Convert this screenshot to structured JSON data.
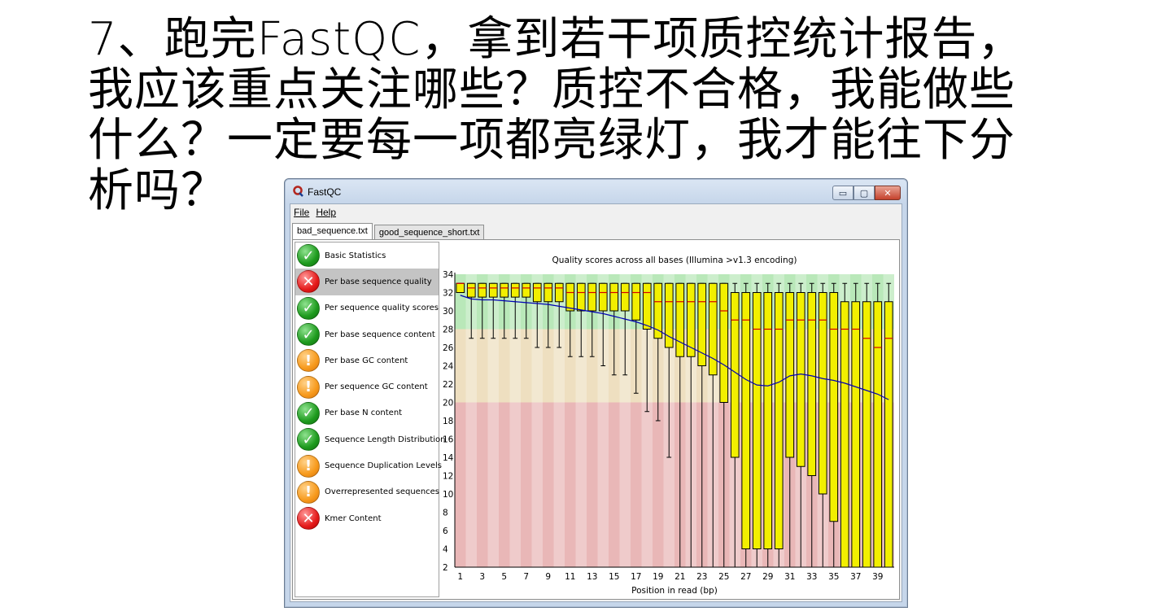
{
  "slide": {
    "title_lines": [
      "7、跑完FastQC，拿到若干项质控统计报告，",
      "我应该重点关注哪些？质控不合格，我能做些",
      "什么？一定要每一项都亮绿灯，我才能往下分",
      "析吗？"
    ]
  },
  "window": {
    "title": "FastQC",
    "menu": {
      "file": "File",
      "help": "Help"
    },
    "controls": {
      "minimize": "▭",
      "maximize": "▢",
      "close": "✕"
    },
    "tabs": [
      {
        "label": "bad_sequence.txt",
        "active": true
      },
      {
        "label": "good_sequence_short.txt",
        "active": false
      }
    ]
  },
  "modules": [
    {
      "label": "Basic Statistics",
      "status": "pass",
      "icon": "check-icon"
    },
    {
      "label": "Per base sequence quality",
      "status": "fail",
      "icon": "cross-icon",
      "selected": true
    },
    {
      "label": "Per sequence quality scores",
      "status": "pass",
      "icon": "check-icon"
    },
    {
      "label": "Per base sequence content",
      "status": "pass",
      "icon": "check-icon"
    },
    {
      "label": "Per base GC content",
      "status": "warn",
      "icon": "exclamation-icon"
    },
    {
      "label": "Per sequence GC content",
      "status": "warn",
      "icon": "exclamation-icon"
    },
    {
      "label": "Per base N content",
      "status": "pass",
      "icon": "check-icon"
    },
    {
      "label": "Sequence Length Distribution",
      "status": "pass",
      "icon": "check-icon"
    },
    {
      "label": "Sequence Duplication Levels",
      "status": "warn",
      "icon": "exclamation-icon"
    },
    {
      "label": "Overrepresented sequences",
      "status": "warn",
      "icon": "exclamation-icon"
    },
    {
      "label": "Kmer Content",
      "status": "fail",
      "icon": "cross-icon"
    }
  ],
  "status_colors": {
    "pass": "#1e9b1e",
    "warn": "#f79a1c",
    "fail": "#e51c1c"
  },
  "chart_data": {
    "type": "box",
    "title": "Quality scores across all bases (Illumina >v1.3 encoding)",
    "xlabel": "Position in read (bp)",
    "ylabel": "",
    "ylim": [
      2,
      34
    ],
    "yticks": [
      2,
      4,
      6,
      8,
      10,
      12,
      14,
      16,
      18,
      20,
      22,
      24,
      26,
      28,
      30,
      32,
      34
    ],
    "xticks": [
      1,
      3,
      5,
      7,
      9,
      11,
      13,
      15,
      17,
      19,
      21,
      23,
      25,
      27,
      29,
      31,
      33,
      35,
      37,
      39
    ],
    "zones": [
      {
        "from": 28,
        "to": 34,
        "color": "#b9e8b9"
      },
      {
        "from": 20,
        "to": 28,
        "color": "#eedfc0"
      },
      {
        "from": 2,
        "to": 20,
        "color": "#e9b7b7"
      }
    ],
    "colors": {
      "box_fill": "#f2ef00",
      "box_stroke": "#000000",
      "median": "#d40000",
      "mean": "#0000b4",
      "whisker": "#000000"
    },
    "positions": [
      1,
      2,
      3,
      4,
      5,
      6,
      7,
      8,
      9,
      10,
      11,
      12,
      13,
      14,
      15,
      16,
      17,
      18,
      19,
      20,
      21,
      22,
      23,
      24,
      25,
      26,
      27,
      28,
      29,
      30,
      31,
      32,
      33,
      34,
      35,
      36,
      37,
      38,
      39,
      40
    ],
    "box_stats": [
      {
        "low": 32,
        "q1": 32,
        "median": 33,
        "q3": 33,
        "high": 33
      },
      {
        "low": 27,
        "q1": 31.5,
        "median": 32.5,
        "q3": 33,
        "high": 33
      },
      {
        "low": 27,
        "q1": 31.5,
        "median": 32.5,
        "q3": 33,
        "high": 33
      },
      {
        "low": 27,
        "q1": 31.5,
        "median": 32.5,
        "q3": 33,
        "high": 33
      },
      {
        "low": 27,
        "q1": 31.5,
        "median": 32.5,
        "q3": 33,
        "high": 33
      },
      {
        "low": 27,
        "q1": 31.5,
        "median": 32.5,
        "q3": 33,
        "high": 33
      },
      {
        "low": 27,
        "q1": 31.5,
        "median": 32.5,
        "q3": 33,
        "high": 33
      },
      {
        "low": 26,
        "q1": 31,
        "median": 32.5,
        "q3": 33,
        "high": 33
      },
      {
        "low": 26,
        "q1": 31,
        "median": 32.5,
        "q3": 33,
        "high": 33
      },
      {
        "low": 26,
        "q1": 31,
        "median": 32.5,
        "q3": 33,
        "high": 33
      },
      {
        "low": 25,
        "q1": 30,
        "median": 32,
        "q3": 33,
        "high": 33
      },
      {
        "low": 25,
        "q1": 30,
        "median": 32,
        "q3": 33,
        "high": 33
      },
      {
        "low": 25,
        "q1": 30,
        "median": 32,
        "q3": 33,
        "high": 33
      },
      {
        "low": 24,
        "q1": 30,
        "median": 32,
        "q3": 33,
        "high": 33
      },
      {
        "low": 23,
        "q1": 30,
        "median": 32,
        "q3": 33,
        "high": 33
      },
      {
        "low": 23,
        "q1": 30,
        "median": 32,
        "q3": 33,
        "high": 33
      },
      {
        "low": 21,
        "q1": 29,
        "median": 32,
        "q3": 33,
        "high": 33
      },
      {
        "low": 19,
        "q1": 28,
        "median": 32,
        "q3": 33,
        "high": 33
      },
      {
        "low": 18,
        "q1": 27,
        "median": 31,
        "q3": 33,
        "high": 33
      },
      {
        "low": 14,
        "q1": 26,
        "median": 31,
        "q3": 33,
        "high": 33
      },
      {
        "low": 2,
        "q1": 25,
        "median": 31,
        "q3": 33,
        "high": 33
      },
      {
        "low": 2,
        "q1": 25,
        "median": 31,
        "q3": 33,
        "high": 33
      },
      {
        "low": 2,
        "q1": 24,
        "median": 31,
        "q3": 33,
        "high": 33
      },
      {
        "low": 2,
        "q1": 23,
        "median": 31,
        "q3": 33,
        "high": 33
      },
      {
        "low": 2,
        "q1": 20,
        "median": 30,
        "q3": 33,
        "high": 33
      },
      {
        "low": 2,
        "q1": 14,
        "median": 29,
        "q3": 32,
        "high": 33
      },
      {
        "low": 2,
        "q1": 4,
        "median": 29,
        "q3": 32,
        "high": 33
      },
      {
        "low": 2,
        "q1": 4,
        "median": 28,
        "q3": 32,
        "high": 33
      },
      {
        "low": 2,
        "q1": 4,
        "median": 28,
        "q3": 32,
        "high": 33
      },
      {
        "low": 2,
        "q1": 4,
        "median": 28,
        "q3": 32,
        "high": 33
      },
      {
        "low": 2,
        "q1": 14,
        "median": 29,
        "q3": 32,
        "high": 33
      },
      {
        "low": 2,
        "q1": 13,
        "median": 29,
        "q3": 32,
        "high": 33
      },
      {
        "low": 2,
        "q1": 12,
        "median": 29,
        "q3": 32,
        "high": 33
      },
      {
        "low": 2,
        "q1": 10,
        "median": 29,
        "q3": 32,
        "high": 33
      },
      {
        "low": 2,
        "q1": 7,
        "median": 28,
        "q3": 32,
        "high": 33
      },
      {
        "low": 2,
        "q1": 2,
        "median": 28,
        "q3": 31,
        "high": 33
      },
      {
        "low": 2,
        "q1": 2,
        "median": 28,
        "q3": 31,
        "high": 33
      },
      {
        "low": 2,
        "q1": 2,
        "median": 27,
        "q3": 31,
        "high": 33
      },
      {
        "low": 2,
        "q1": 2,
        "median": 26,
        "q3": 31,
        "high": 33
      },
      {
        "low": 2,
        "q1": 2,
        "median": 27,
        "q3": 31,
        "high": 33
      }
    ],
    "mean": [
      31.7,
      31.3,
      31.2,
      31.2,
      31.1,
      31.0,
      30.9,
      30.8,
      30.7,
      30.5,
      30.3,
      30.1,
      29.9,
      29.7,
      29.4,
      29.1,
      28.8,
      28.4,
      27.9,
      27.2,
      26.6,
      26.0,
      25.4,
      24.8,
      24.1,
      23.3,
      22.5,
      21.9,
      21.8,
      22.2,
      22.9,
      23.1,
      22.9,
      22.6,
      22.4,
      22.1,
      21.7,
      21.3,
      20.9,
      20.3
    ]
  }
}
